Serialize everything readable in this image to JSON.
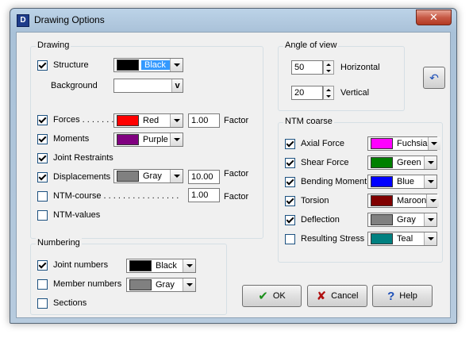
{
  "window": {
    "title": "Drawing Options",
    "close_symbol": "✕"
  },
  "drawing": {
    "legend": "Drawing",
    "structure": {
      "label": "Structure",
      "checked": true,
      "color": "#000000",
      "color_name": "Black"
    },
    "background_label": "Background",
    "background_btn": "v",
    "forces": {
      "label": "Forces . . . . . . .",
      "checked": true,
      "color": "#ff0000",
      "color_name": "Red",
      "factor": "1.00",
      "factor_label": "Factor"
    },
    "moments": {
      "label": "Moments",
      "checked": true,
      "color": "#800080",
      "color_name": "Purple"
    },
    "joint_restraints": {
      "label": "Joint Restraints",
      "checked": true
    },
    "displacements": {
      "label": "Displacements",
      "checked": true,
      "color": "#808080",
      "color_name": "Gray",
      "factor": "10.00",
      "factor_label": "Factor"
    },
    "ntm_course": {
      "label": "NTM-course . . . . . . . . . . . . . . . .",
      "checked": false,
      "factor": "1.00",
      "factor_label": "Factor"
    },
    "ntm_values": {
      "label": "NTM-values",
      "checked": false
    }
  },
  "numbering": {
    "legend": "Numbering",
    "joint_numbers": {
      "label": "Joint numbers",
      "checked": true,
      "color": "#000000",
      "color_name": "Black"
    },
    "member_numbers": {
      "label": "Member numbers",
      "checked": false,
      "color": "#808080",
      "color_name": "Gray"
    },
    "sections": {
      "label": "Sections",
      "checked": false
    }
  },
  "angle": {
    "legend": "Angle of view",
    "horizontal": {
      "value": "50",
      "label": "Horizontal"
    },
    "vertical": {
      "value": "20",
      "label": "Vertical"
    }
  },
  "ntm": {
    "legend": "NTM coarse",
    "items": [
      {
        "label": "Axial Force",
        "checked": true,
        "color": "#ff00ff",
        "color_name": "Fuchsia"
      },
      {
        "label": "Shear Force",
        "checked": true,
        "color": "#008000",
        "color_name": "Green"
      },
      {
        "label": "Bending Moment",
        "checked": true,
        "color": "#0000ff",
        "color_name": "Blue"
      },
      {
        "label": "Torsion",
        "checked": true,
        "color": "#800000",
        "color_name": "Maroon"
      },
      {
        "label": "Deflection",
        "checked": true,
        "color": "#808080",
        "color_name": "Gray"
      },
      {
        "label": "Resulting Stress",
        "checked": false,
        "color": "#008080",
        "color_name": "Teal"
      }
    ]
  },
  "buttons": {
    "ok": "OK",
    "cancel": "Cancel",
    "help": "Help",
    "ok_icon": "✔",
    "cancel_icon": "✘",
    "help_icon": "?",
    "reset_icon": "↶"
  },
  "colors": {
    "check_ok": "#1a8f1a",
    "check_cancel": "#b01010",
    "help_blue": "#1d4fb8"
  }
}
